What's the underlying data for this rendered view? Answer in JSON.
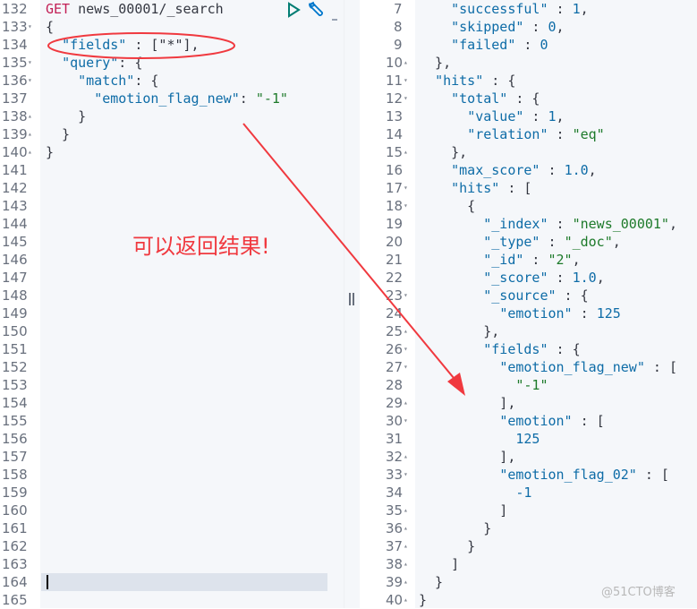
{
  "request": {
    "method": "GET",
    "path": "news_00001/_search",
    "lines": [
      {
        "n": "132",
        "fold": "",
        "html": ""
      },
      {
        "n": "133",
        "fold": "▾",
        "t": "{"
      },
      {
        "n": "134",
        "fold": "",
        "t": "  \"fields\" : [\"*\"],"
      },
      {
        "n": "135",
        "fold": "▾",
        "t": "  \"query\": {"
      },
      {
        "n": "136",
        "fold": "▾",
        "t": "    \"match\": {"
      },
      {
        "n": "137",
        "fold": "",
        "t": "      \"emotion_flag_new\": \"-1\""
      },
      {
        "n": "138",
        "fold": "▴",
        "t": "    }"
      },
      {
        "n": "139",
        "fold": "▴",
        "t": "  }"
      },
      {
        "n": "140",
        "fold": "▴",
        "t": "}"
      },
      {
        "n": "141"
      },
      {
        "n": "142"
      },
      {
        "n": "143"
      },
      {
        "n": "144"
      },
      {
        "n": "145"
      },
      {
        "n": "146"
      },
      {
        "n": "147"
      },
      {
        "n": "148"
      },
      {
        "n": "149"
      },
      {
        "n": "150"
      },
      {
        "n": "151"
      },
      {
        "n": "152"
      },
      {
        "n": "153"
      },
      {
        "n": "154"
      },
      {
        "n": "155"
      },
      {
        "n": "156"
      },
      {
        "n": "157"
      },
      {
        "n": "158"
      },
      {
        "n": "159"
      },
      {
        "n": "160"
      },
      {
        "n": "161"
      },
      {
        "n": "162"
      },
      {
        "n": "163"
      },
      {
        "n": "164"
      },
      {
        "n": "165"
      }
    ]
  },
  "toolbar": {
    "run_icon": "play-icon",
    "settings_icon": "wrench-icon"
  },
  "annotation": {
    "text": "可以返回结果!",
    "color": "#f0393f"
  },
  "response": {
    "lines": [
      {
        "n": "7",
        "fold": "",
        "t": "    \"successful\" : 1,"
      },
      {
        "n": "8",
        "fold": "",
        "t": "    \"skipped\" : 0,"
      },
      {
        "n": "9",
        "fold": "",
        "t": "    \"failed\" : 0"
      },
      {
        "n": "10",
        "fold": "▴",
        "t": "  },"
      },
      {
        "n": "11",
        "fold": "▾",
        "t": "  \"hits\" : {"
      },
      {
        "n": "12",
        "fold": "▾",
        "t": "    \"total\" : {"
      },
      {
        "n": "13",
        "fold": "",
        "t": "      \"value\" : 1,"
      },
      {
        "n": "14",
        "fold": "",
        "t": "      \"relation\" : \"eq\""
      },
      {
        "n": "15",
        "fold": "▴",
        "t": "    },"
      },
      {
        "n": "16",
        "fold": "",
        "t": "    \"max_score\" : 1.0,"
      },
      {
        "n": "17",
        "fold": "▾",
        "t": "    \"hits\" : ["
      },
      {
        "n": "18",
        "fold": "▾",
        "t": "      {"
      },
      {
        "n": "19",
        "fold": "",
        "t": "        \"_index\" : \"news_00001\","
      },
      {
        "n": "20",
        "fold": "",
        "t": "        \"_type\" : \"_doc\","
      },
      {
        "n": "21",
        "fold": "",
        "t": "        \"_id\" : \"2\","
      },
      {
        "n": "22",
        "fold": "",
        "t": "        \"_score\" : 1.0,"
      },
      {
        "n": "23",
        "fold": "▾",
        "t": "        \"_source\" : {"
      },
      {
        "n": "24",
        "fold": "",
        "t": "          \"emotion\" : 125"
      },
      {
        "n": "25",
        "fold": "▴",
        "t": "        },"
      },
      {
        "n": "26",
        "fold": "▾",
        "t": "        \"fields\" : {"
      },
      {
        "n": "27",
        "fold": "▾",
        "t": "          \"emotion_flag_new\" : ["
      },
      {
        "n": "28",
        "fold": "",
        "t": "            \"-1\""
      },
      {
        "n": "29",
        "fold": "▴",
        "t": "          ],"
      },
      {
        "n": "30",
        "fold": "▾",
        "t": "          \"emotion\" : ["
      },
      {
        "n": "31",
        "fold": "",
        "t": "            125"
      },
      {
        "n": "32",
        "fold": "▴",
        "t": "          ],"
      },
      {
        "n": "33",
        "fold": "▾",
        "t": "          \"emotion_flag_02\" : ["
      },
      {
        "n": "34",
        "fold": "",
        "t": "            -1"
      },
      {
        "n": "35",
        "fold": "▴",
        "t": "          ]"
      },
      {
        "n": "36",
        "fold": "▴",
        "t": "        }"
      },
      {
        "n": "37",
        "fold": "▴",
        "t": "      }"
      },
      {
        "n": "38",
        "fold": "▴",
        "t": "    ]"
      },
      {
        "n": "39",
        "fold": "▴",
        "t": "  }"
      },
      {
        "n": "40",
        "fold": "▴",
        "t": "}"
      }
    ]
  },
  "watermark": "@51CTO博客"
}
